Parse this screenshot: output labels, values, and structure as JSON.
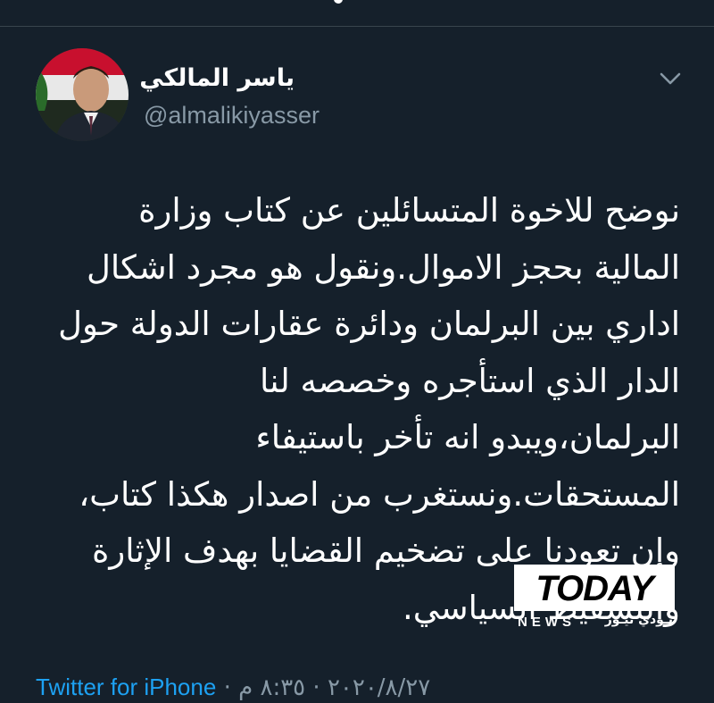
{
  "author": {
    "display_name": "ياسر المالكي",
    "handle": "@almalikiyasser",
    "avatar_icon": "profile-photo"
  },
  "menu": {
    "icon": "chevron-down-icon"
  },
  "tweet": {
    "lines": [
      "نوضح للاخوة المتسائلين عن كتاب وزارة",
      "المالية بحجز الاموال.ونقول هو مجرد اشكال",
      "اداري بين البرلمان ودائرة عقارات الدولة حول",
      "الدار الذي استأجره وخصصه لنا",
      "البرلمان،ويبدو انه تأخر باستيفاء",
      "المستحقات.ونستغرب من اصدار هكذا كتاب،",
      "وإن تعودنا على تضخيم القضايا بهدف الإثارة",
      "والتسقيط السياسي."
    ]
  },
  "footer": {
    "source": "Twitter for iPhone",
    "separator": " · ",
    "date": "٢٠٢٠/٨/٢٧",
    "time": "٨:٣٥ م"
  },
  "watermark": {
    "title": "TODAY",
    "subtitle": "NEWS",
    "arabic": "تـودي نيـوز"
  },
  "colors": {
    "background": "#15202b",
    "text": "#ffffff",
    "secondary": "#8899a6",
    "link": "#1da1f2",
    "divider": "#38444d"
  }
}
